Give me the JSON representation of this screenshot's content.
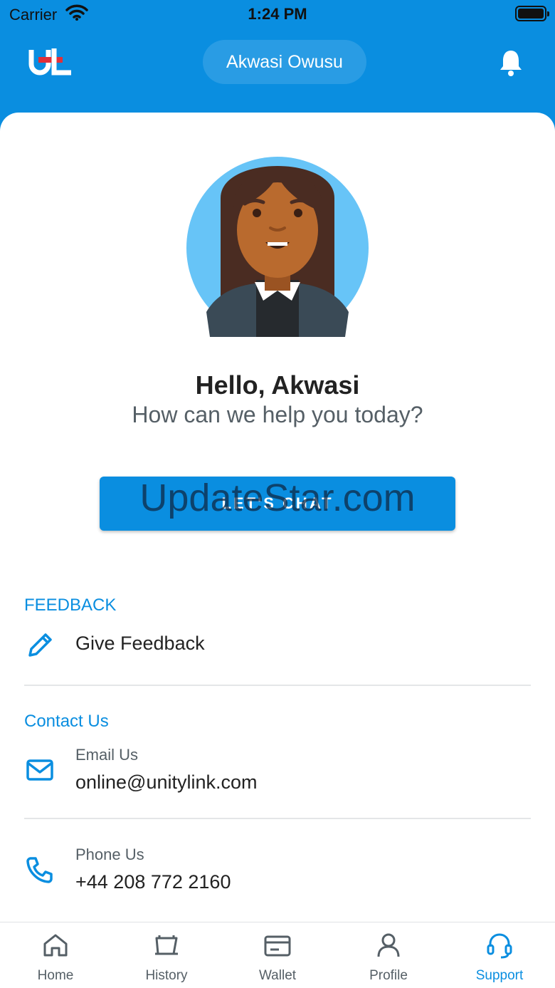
{
  "status_bar": {
    "carrier": "Carrier",
    "time": "1:24 PM"
  },
  "header": {
    "user_name": "Akwasi Owusu"
  },
  "greeting": {
    "hello": "Hello, Akwasi",
    "help": "How can we help you today?"
  },
  "chat_button": {
    "label": "LET'S CHAT"
  },
  "watermark": "UpdateStar.com",
  "feedback": {
    "section_title": "FEEDBACK",
    "give_feedback_label": "Give Feedback"
  },
  "contact": {
    "section_title": "Contact Us",
    "email_label": "Email Us",
    "email_value": "online@unitylink.com",
    "phone_label": "Phone Us",
    "phone_value": "+44 208 772 2160"
  },
  "tabs": [
    {
      "label": "Home",
      "icon": "home-icon"
    },
    {
      "label": "History",
      "icon": "history-icon"
    },
    {
      "label": "Wallet",
      "icon": "wallet-icon"
    },
    {
      "label": "Profile",
      "icon": "profile-icon"
    },
    {
      "label": "Support",
      "icon": "headset-icon",
      "active": true
    }
  ],
  "colors": {
    "brand": "#0a8ee0",
    "text_dark": "#222222",
    "text_muted": "#555f66"
  }
}
